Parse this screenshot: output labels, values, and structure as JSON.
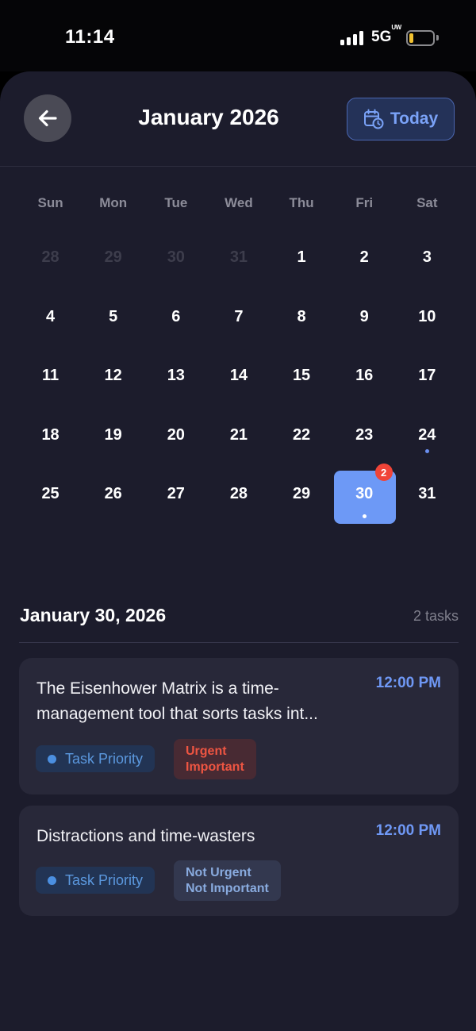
{
  "status": {
    "time": "11:14",
    "network": "5G",
    "network_sup": "UW"
  },
  "header": {
    "title": "January 2026",
    "today_label": "Today"
  },
  "weekdays": [
    "Sun",
    "Mon",
    "Tue",
    "Wed",
    "Thu",
    "Fri",
    "Sat"
  ],
  "calendar": {
    "days": [
      {
        "label": "28",
        "muted": true
      },
      {
        "label": "29",
        "muted": true
      },
      {
        "label": "30",
        "muted": true
      },
      {
        "label": "31",
        "muted": true
      },
      {
        "label": "1"
      },
      {
        "label": "2"
      },
      {
        "label": "3"
      },
      {
        "label": "4"
      },
      {
        "label": "5"
      },
      {
        "label": "6"
      },
      {
        "label": "7"
      },
      {
        "label": "8"
      },
      {
        "label": "9"
      },
      {
        "label": "10"
      },
      {
        "label": "11"
      },
      {
        "label": "12"
      },
      {
        "label": "13"
      },
      {
        "label": "14"
      },
      {
        "label": "15"
      },
      {
        "label": "16"
      },
      {
        "label": "17"
      },
      {
        "label": "18"
      },
      {
        "label": "19"
      },
      {
        "label": "20"
      },
      {
        "label": "21"
      },
      {
        "label": "22"
      },
      {
        "label": "23"
      },
      {
        "label": "24",
        "dot": true
      },
      {
        "label": "25"
      },
      {
        "label": "26"
      },
      {
        "label": "27"
      },
      {
        "label": "28"
      },
      {
        "label": "29"
      },
      {
        "label": "30",
        "selected": true,
        "dot": true,
        "badge": "2"
      },
      {
        "label": "31"
      }
    ]
  },
  "selected_day": {
    "date": "January 30, 2026",
    "count": "2 tasks"
  },
  "tasks": [
    {
      "text_line1": "The Eisenhower Matrix is a time-",
      "text_line2": "management tool that sorts tasks int...",
      "time": "12:00 PM",
      "category": "Task Priority",
      "quadrant_line1": "Urgent",
      "quadrant_line2": "Important"
    },
    {
      "text_line1": "Distractions and time-wasters",
      "time": "12:00 PM",
      "category": "Task Priority",
      "quadrant_line1": "Not Urgent",
      "quadrant_line2": "Not Important"
    }
  ],
  "colors": {
    "sheet_bg": "#1c1c2c",
    "accent": "#6d99f6",
    "badge": "#f04438",
    "urgent_text": "#ef5542",
    "category_text": "#5b98de"
  }
}
